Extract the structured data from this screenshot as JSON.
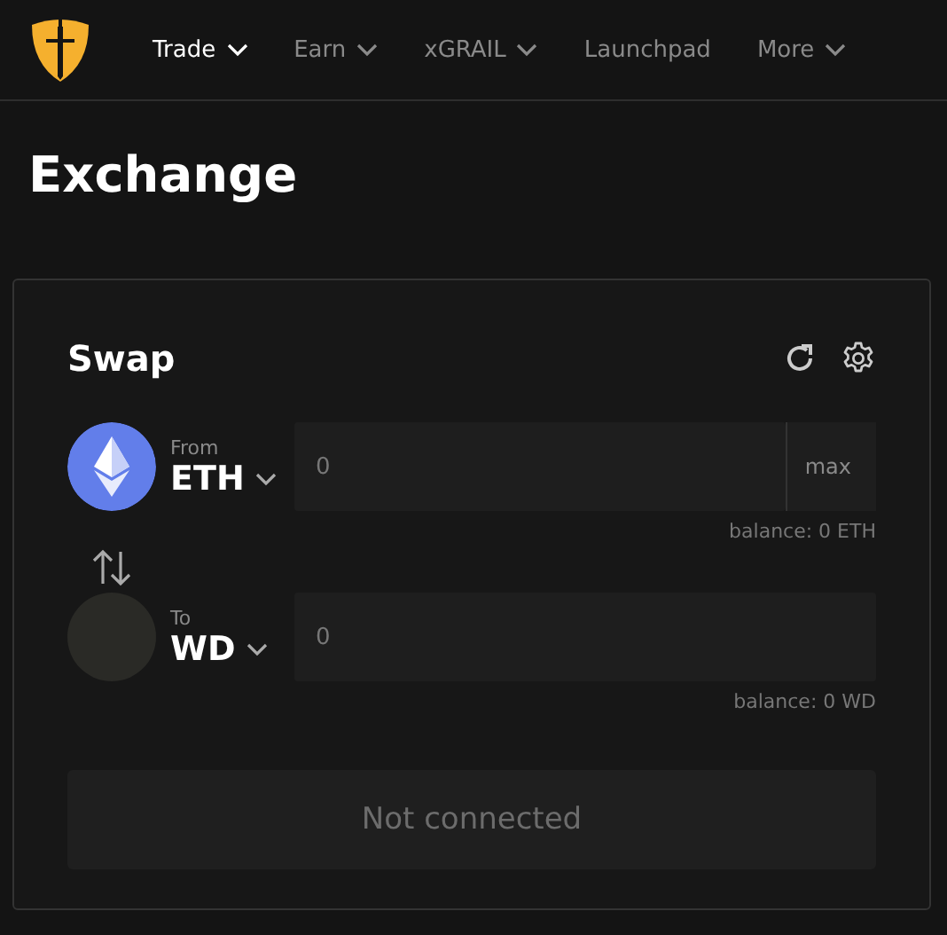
{
  "nav": [
    {
      "label": "Trade",
      "dropdown": true,
      "selected": true
    },
    {
      "label": "Earn",
      "dropdown": true,
      "selected": false
    },
    {
      "label": "xGRAIL",
      "dropdown": true,
      "selected": false
    },
    {
      "label": "Launchpad",
      "dropdown": false,
      "selected": false
    },
    {
      "label": "More",
      "dropdown": true,
      "selected": false
    }
  ],
  "page_title": "Exchange",
  "swap": {
    "title": "Swap",
    "tokens": [
      {
        "label": "From",
        "symbol": "ETH",
        "kind": "eth",
        "amount": "0",
        "max": "max",
        "balance": "balance: 0 ETH"
      },
      {
        "label": "To",
        "symbol": "WD",
        "kind": "blank",
        "amount": "0",
        "balance": "balance: 0 WD"
      }
    ],
    "submit": {
      "label": "Not connected",
      "disabled": true
    }
  }
}
